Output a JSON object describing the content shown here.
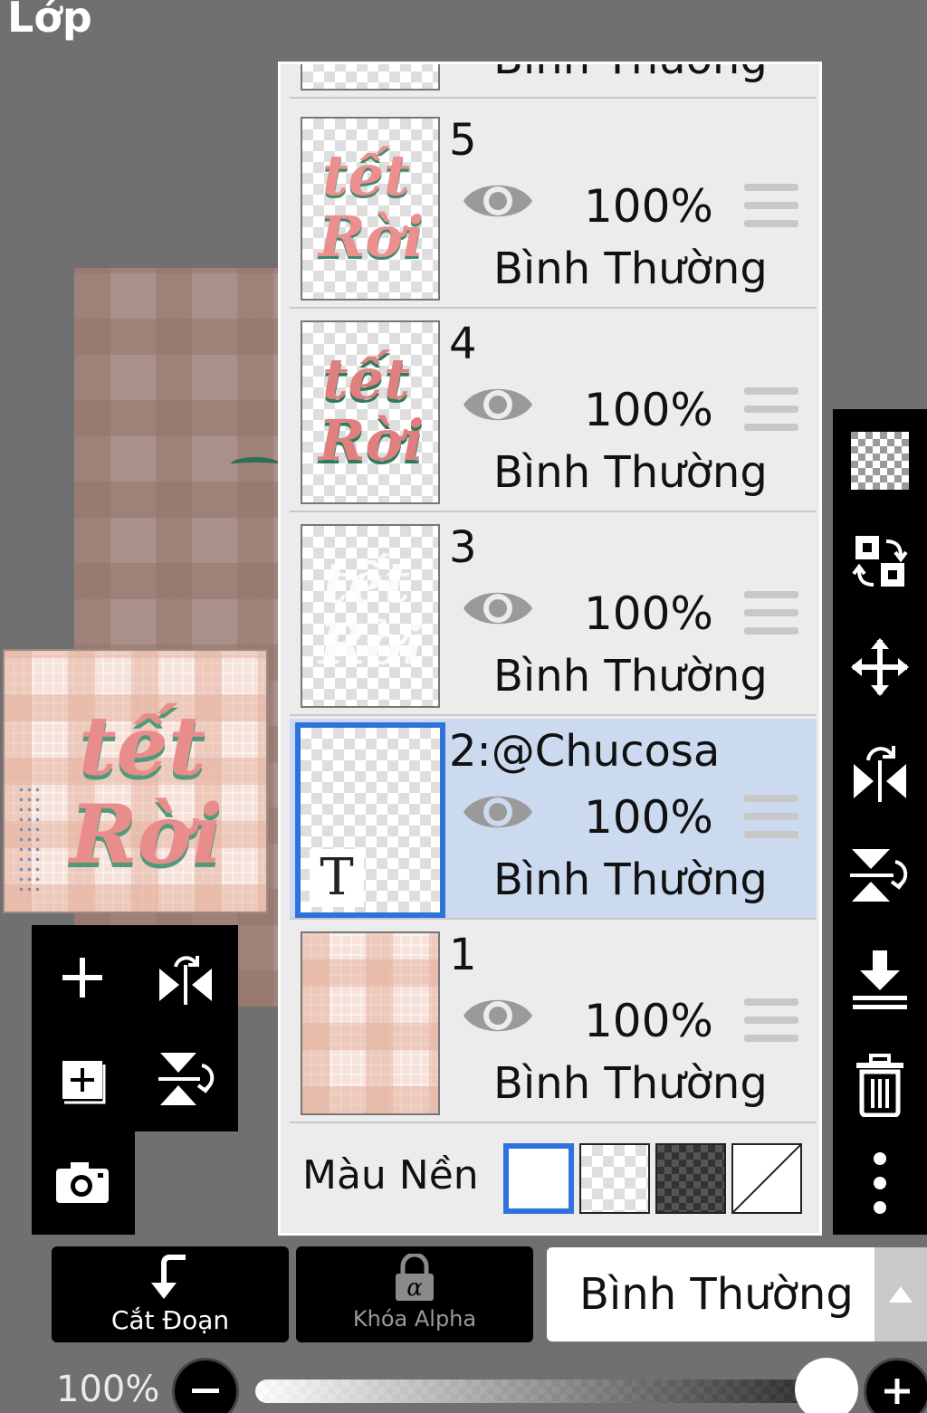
{
  "screen": {
    "title": "Lớp"
  },
  "preview": {
    "line1": "tết",
    "line2": "Rời"
  },
  "layers": [
    {
      "name": "5",
      "opacity": "100%",
      "mode": "Bình Thường",
      "thumb_line1": "tết",
      "thumb_line2": "Rời",
      "selected": false
    },
    {
      "name": "4",
      "opacity": "100%",
      "mode": "Bình Thường",
      "thumb_line1": "tết",
      "thumb_line2": "Rời",
      "selected": false
    },
    {
      "name": "3",
      "opacity": "100%",
      "mode": "Bình Thường",
      "thumb_line1": "tết",
      "thumb_line2": "Rời",
      "selected": false
    },
    {
      "name": "2:@Chucosa",
      "opacity": "100%",
      "mode": "Bình Thường",
      "thumb_badge": "T",
      "selected": true
    },
    {
      "name": "1",
      "opacity": "100%",
      "mode": "Bình Thường",
      "selected": false
    }
  ],
  "partial_layer_top": {
    "mode": "Bình Thường"
  },
  "background": {
    "label": "Màu Nền",
    "options": [
      "white",
      "checker-light",
      "checker-dark",
      "none"
    ],
    "selected": "white"
  },
  "bottom": {
    "clip_label": "Cắt Đoạn",
    "alpha_lock_label": "Khóa Alpha",
    "blend_mode": "Bình Thường",
    "opacity": "100%"
  },
  "colors": {
    "accent": "#2d73db",
    "selected_row": "#cbdaee",
    "panel": "#ececec",
    "preview_pink": "#e98c8c",
    "preview_green": "#4f9a78"
  },
  "icons": {
    "left_tools": [
      "plus-icon",
      "flip-horizontal-icon",
      "add-layer-icon",
      "flip-vertical-icon",
      "camera-icon"
    ],
    "right_tools": [
      "checkerboard-icon",
      "swap-icon",
      "move-icon",
      "flip-horizontal-icon",
      "flip-vertical-icon",
      "merge-down-icon",
      "trash-icon",
      "more-vertical-icon"
    ]
  }
}
